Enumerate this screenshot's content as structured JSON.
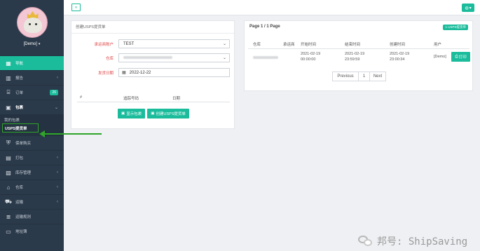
{
  "user": {
    "name": "[Demo]"
  },
  "sidebar": {
    "items": [
      {
        "label": "导航",
        "icon": "grid-icon"
      },
      {
        "label": "报告",
        "icon": "chart-icon"
      },
      {
        "label": "订单",
        "icon": "cart-icon",
        "badge": "26"
      },
      {
        "label": "包裹",
        "icon": "box-icon"
      },
      {
        "label": "保单购买",
        "icon": "shield-icon"
      },
      {
        "label": "打包",
        "icon": "pack-icon"
      },
      {
        "label": "库存管理",
        "icon": "warehouse-icon"
      },
      {
        "label": "仓库",
        "icon": "store-icon"
      },
      {
        "label": "运输",
        "icon": "truck-icon"
      },
      {
        "label": "运输规则",
        "icon": "rules-icon"
      },
      {
        "label": "地址簿",
        "icon": "book-icon"
      }
    ],
    "subitems": [
      {
        "label": "我的包裹"
      },
      {
        "label": "USPS提货单"
      }
    ]
  },
  "left_panel": {
    "title": "创建USPS提货单",
    "carrier_label": "承运商账户",
    "carrier_value": "TEST",
    "warehouse_label": "仓库",
    "pickup_date_label": "发货日期",
    "pickup_date_value": "2022-12-22",
    "table_headers": [
      "#",
      "追踪号码",
      "日期"
    ],
    "show_packages_btn": "显示包裹",
    "create_btn": "创建USPS提货单"
  },
  "right_panel": {
    "page_info": "Page 1 / 1 Page",
    "count_badge": "1 USPS提货单",
    "headers": [
      "仓库",
      "承运商",
      "开始时间",
      "结束时间",
      "创建时间",
      "用户"
    ],
    "row": {
      "start_date": "2021-02-19",
      "start_time": "00:00:00",
      "end_date": "2021-02-19",
      "end_time": "23:59:59",
      "created_date": "2021-02-19",
      "created_time": "23:00:34",
      "user": "[Demo]",
      "print_label": "打印"
    },
    "pager": {
      "prev": "Previous",
      "page": "1",
      "next": "Next"
    }
  },
  "watermark": {
    "text": "邦号: ShipSaving"
  },
  "colors": {
    "accent": "#1abc9c",
    "sidebar": "#2b3a4a",
    "highlight": "#2fa52a",
    "required": "#e04848"
  }
}
